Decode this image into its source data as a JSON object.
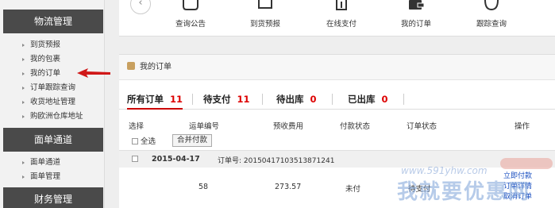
{
  "sidebar": {
    "sections": [
      {
        "title": "物流管理",
        "items": [
          "到货预报",
          "我的包裹",
          "我的订单",
          "订单跟踪查询",
          "收货地址管理",
          "购欧洲仓库地址"
        ]
      },
      {
        "title": "面单通道",
        "items": [
          "面单通道",
          "面单管理"
        ]
      },
      {
        "title": "财务管理",
        "items": []
      }
    ]
  },
  "topnav": {
    "back": "‹",
    "items": [
      {
        "label": "查询公告",
        "icon": "announcement-icon"
      },
      {
        "label": "到货预报",
        "icon": "forecast-icon"
      },
      {
        "label": "在线支付",
        "icon": "payment-icon"
      },
      {
        "label": "我的订单",
        "icon": "wallet-icon"
      },
      {
        "label": "跟踪查询",
        "icon": "tracking-icon"
      }
    ]
  },
  "panel": {
    "title": "我的订单"
  },
  "tabs": [
    {
      "label": "所有订单",
      "count": "11"
    },
    {
      "label": "待支付",
      "count": "11"
    },
    {
      "label": "待出库",
      "count": "0"
    },
    {
      "label": "已出库",
      "count": "0"
    }
  ],
  "table": {
    "headers": [
      "选择",
      "运单编号",
      "预收费用",
      "付款状态",
      "订单状态",
      "操作"
    ],
    "select_all": "全选",
    "merge_pay": "合并付款",
    "order": {
      "date": "2015-04-17",
      "order_no": "订单号: 20150417103513871241",
      "waybill": "58",
      "fee": "273.57",
      "pay_status": "未付",
      "order_status": "待支付",
      "actions": [
        "立即付款",
        "订单详情",
        "取消订单"
      ]
    }
  },
  "watermark": {
    "url": "www.591yhw.com",
    "text": "我就要优惠网"
  },
  "colors": {
    "accent": "#cc0000",
    "sidebar_head": "#4a4a4a",
    "link": "#1a4fc0"
  }
}
